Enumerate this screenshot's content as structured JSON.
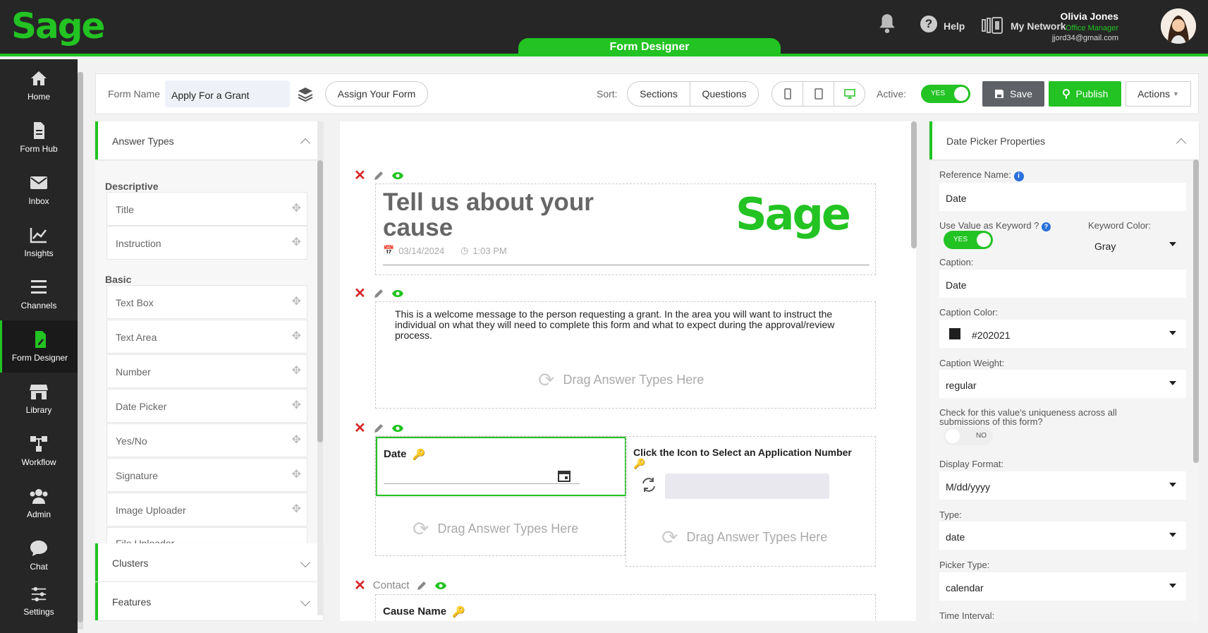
{
  "app": {
    "brand": "Sage",
    "tab": "Form Designer"
  },
  "header": {
    "help_label": "Help",
    "network_label": "My Network",
    "user_name": "Olivia Jones",
    "user_role": "Office Manager",
    "user_email": "jjord34@gmail.com"
  },
  "sidebar": {
    "items": [
      {
        "label": "Home",
        "icon": "home-icon"
      },
      {
        "label": "Form Hub",
        "icon": "document-icon"
      },
      {
        "label": "Inbox",
        "icon": "mail-icon"
      },
      {
        "label": "Insights",
        "icon": "chart-icon"
      },
      {
        "label": "Channels",
        "icon": "menu-icon"
      },
      {
        "label": "Form Designer",
        "icon": "form-edit-icon",
        "active": true
      },
      {
        "label": "Library",
        "icon": "store-icon"
      },
      {
        "label": "Workflow",
        "icon": "workflow-icon"
      },
      {
        "label": "Admin",
        "icon": "users-icon"
      },
      {
        "label": "Chat",
        "icon": "chat-icon"
      },
      {
        "label": "Settings",
        "icon": "sliders-icon"
      }
    ]
  },
  "toolbar": {
    "form_name_label": "Form Name",
    "form_name_value": "Apply For a Grant",
    "assign_label": "Assign Your Form",
    "sort_label": "Sort:",
    "sort_sections": "Sections",
    "sort_questions": "Questions",
    "active_label": "Active:",
    "active_toggle": "YES",
    "save_label": "Save",
    "publish_label": "Publish",
    "actions_label": "Actions"
  },
  "answer_types": {
    "title": "Answer Types",
    "descriptive_label": "Descriptive",
    "descriptive": [
      "Title",
      "Instruction"
    ],
    "basic_label": "Basic",
    "basic": [
      "Text Box",
      "Text Area",
      "Number",
      "Date Picker",
      "Yes/No",
      "Signature",
      "Image Uploader",
      "File Uploader"
    ],
    "clusters_label": "Clusters",
    "features_label": "Features"
  },
  "canvas": {
    "title": "Tell us about your cause",
    "date": "03/14/2024",
    "time": "1:03 PM",
    "welcome": "This is a welcome message to the person requesting a grant. In the area you will want to instruct the individual on what they will need to complete this form and what to expect during the approval/review process.",
    "drag_text": "Drag Answer Types Here",
    "date_field_label": "Date",
    "app_number_label": "Click the Icon to Select an Application Number",
    "contact_label": "Contact",
    "cause_name_label": "Cause Name"
  },
  "properties": {
    "title": "Date Picker Properties",
    "reference_name_label": "Reference Name:",
    "reference_name": "Date",
    "use_keyword_label": "Use Value as Keyword ?",
    "use_keyword_toggle": "YES",
    "keyword_color_label": "Keyword Color:",
    "keyword_color": "Gray",
    "caption_label": "Caption:",
    "caption": "Date",
    "caption_color_label": "Caption Color:",
    "caption_color": "#202021",
    "caption_weight_label": "Caption Weight:",
    "caption_weight": "regular",
    "uniqueness_label": "Check for this value's uniqueness across all submissions of this form?",
    "uniqueness_toggle": "NO",
    "display_format_label": "Display Format:",
    "display_format": "M/dd/yyyy",
    "type_label": "Type:",
    "type": "date",
    "picker_type_label": "Picker Type:",
    "picker_type": "calendar",
    "time_interval_label": "Time Interval:"
  },
  "colors": {
    "accent": "#22c322",
    "dark": "#262626",
    "delete": "#d62828"
  }
}
